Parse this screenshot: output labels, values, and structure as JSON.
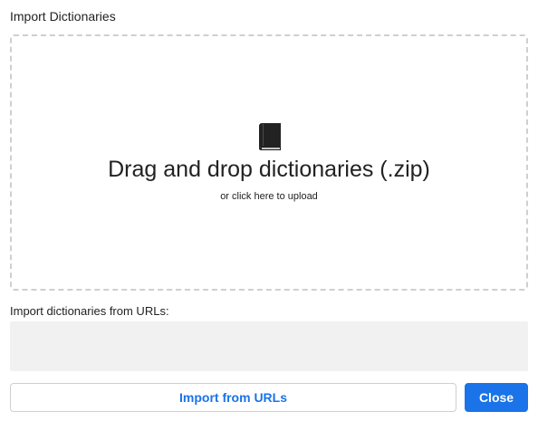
{
  "dialog": {
    "title": "Import Dictionaries"
  },
  "dropzone": {
    "icon": "book-icon",
    "main_text": "Drag and drop dictionaries (.zip)",
    "sub_text": "or click here to upload"
  },
  "urls": {
    "label": "Import dictionaries from URLs:",
    "value": "",
    "placeholder": ""
  },
  "buttons": {
    "import_label": "Import from URLs",
    "close_label": "Close"
  },
  "colors": {
    "accent": "#1a73e8",
    "dropzone_border": "#cfcfcf",
    "textarea_bg": "#f1f1f1"
  }
}
